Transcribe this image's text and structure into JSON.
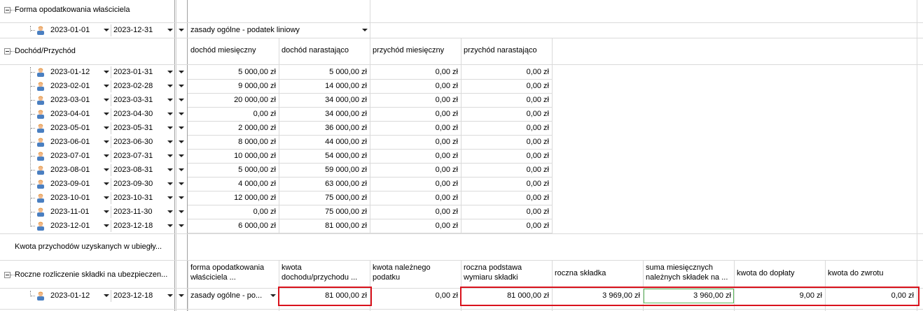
{
  "sections": {
    "forma_title": "Forma opodatkowania właściciela",
    "dochod_title": "Dochód/Przychód",
    "kwota_title": "Kwota przychodów uzyskanych w ubiegły...",
    "roczne_title": "Roczne rozliczenie składki na ubezpieczen..."
  },
  "forma_row": {
    "from": "2023-01-01",
    "to": "2023-12-31",
    "value": "zasady ogólne - podatek liniowy"
  },
  "dochod_headers": [
    "dochód miesięczny",
    "dochód narastająco",
    "przychód miesięczny",
    "przychód narastająco"
  ],
  "dochod_rows": [
    {
      "from": "2023-01-12",
      "to": "2023-01-31",
      "c1": "5 000,00 zł",
      "c2": "5 000,00 zł",
      "c3": "0,00 zł",
      "c4": "0,00 zł"
    },
    {
      "from": "2023-02-01",
      "to": "2023-02-28",
      "c1": "9 000,00 zł",
      "c2": "14 000,00 zł",
      "c3": "0,00 zł",
      "c4": "0,00 zł"
    },
    {
      "from": "2023-03-01",
      "to": "2023-03-31",
      "c1": "20 000,00 zł",
      "c2": "34 000,00 zł",
      "c3": "0,00 zł",
      "c4": "0,00 zł"
    },
    {
      "from": "2023-04-01",
      "to": "2023-04-30",
      "c1": "0,00 zł",
      "c2": "34 000,00 zł",
      "c3": "0,00 zł",
      "c4": "0,00 zł"
    },
    {
      "from": "2023-05-01",
      "to": "2023-05-31",
      "c1": "2 000,00 zł",
      "c2": "36 000,00 zł",
      "c3": "0,00 zł",
      "c4": "0,00 zł"
    },
    {
      "from": "2023-06-01",
      "to": "2023-06-30",
      "c1": "8 000,00 zł",
      "c2": "44 000,00 zł",
      "c3": "0,00 zł",
      "c4": "0,00 zł"
    },
    {
      "from": "2023-07-01",
      "to": "2023-07-31",
      "c1": "10 000,00 zł",
      "c2": "54 000,00 zł",
      "c3": "0,00 zł",
      "c4": "0,00 zł"
    },
    {
      "from": "2023-08-01",
      "to": "2023-08-31",
      "c1": "5 000,00 zł",
      "c2": "59 000,00 zł",
      "c3": "0,00 zł",
      "c4": "0,00 zł"
    },
    {
      "from": "2023-09-01",
      "to": "2023-09-30",
      "c1": "4 000,00 zł",
      "c2": "63 000,00 zł",
      "c3": "0,00 zł",
      "c4": "0,00 zł"
    },
    {
      "from": "2023-10-01",
      "to": "2023-10-31",
      "c1": "12 000,00 zł",
      "c2": "75 000,00 zł",
      "c3": "0,00 zł",
      "c4": "0,00 zł"
    },
    {
      "from": "2023-11-01",
      "to": "2023-11-30",
      "c1": "0,00 zł",
      "c2": "75 000,00 zł",
      "c3": "0,00 zł",
      "c4": "0,00 zł"
    },
    {
      "from": "2023-12-01",
      "to": "2023-12-18",
      "c1": "6 000,00 zł",
      "c2": "81 000,00 zł",
      "c3": "0,00 zł",
      "c4": "0,00 zł"
    }
  ],
  "roczne_headers": [
    [
      "forma opodatkowania",
      "właściciela ..."
    ],
    [
      "kwota",
      "dochodu/przychodu ..."
    ],
    [
      "kwota należnego",
      "podatku"
    ],
    [
      "roczna podstawa",
      "wymiaru składki"
    ],
    [
      "roczna składka",
      ""
    ],
    [
      "suma miesięcznych",
      "należnych składek na ..."
    ],
    [
      "kwota do dopłaty",
      ""
    ],
    [
      "kwota do zwrotu",
      ""
    ]
  ],
  "roczne_row": {
    "from": "2023-01-12",
    "to": "2023-12-18",
    "values": [
      "zasady ogólne - po...",
      "81 000,00 zł",
      "0,00 zł",
      "81 000,00 zł",
      "3 969,00 zł",
      "3 960,00 zł",
      "9,00 zł",
      "0,00 zł"
    ]
  },
  "colors": {
    "highlight": "#d9121c",
    "focus": "#5cb85c",
    "gridline": "#dadada"
  }
}
